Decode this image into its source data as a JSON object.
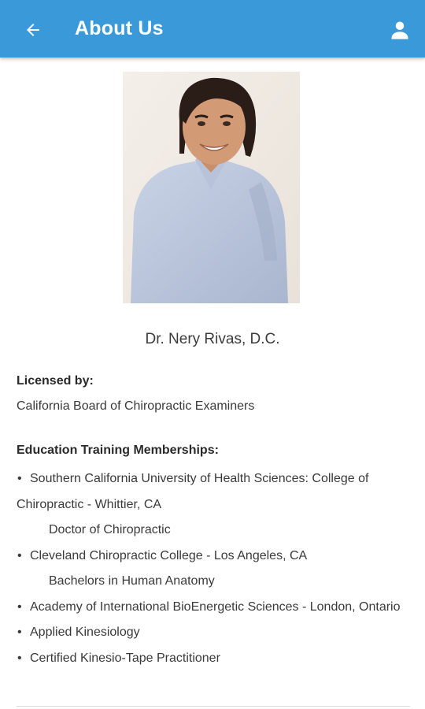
{
  "header": {
    "title": "About Us",
    "back_icon": "arrow-left-icon",
    "profile_icon": "user-icon",
    "bar_color": "#3a9ad9"
  },
  "profile": {
    "name": "Dr. Nery Rivas, D.C."
  },
  "license": {
    "heading": "Licensed by:",
    "text": "California Board of Chiropractic Examiners"
  },
  "education": {
    "heading": "Education Training Memberships:",
    "items": [
      {
        "bullet": "•",
        "text": "Southern California University of Health Sciences: College of Chiropractic - Whittier, CA",
        "sub": "Doctor of Chiropractic"
      },
      {
        "bullet": "•",
        "text": "Cleveland Chiropractic College - Los Angeles, CA",
        "sub": "Bachelors in Human Anatomy"
      },
      {
        "bullet": "•",
        "text": "Academy of International BioEnergetic Sciences - London, Ontario"
      },
      {
        "bullet": "•",
        "text": "Applied Kinesiology"
      },
      {
        "bullet": "•",
        "text": "Certified Kinesio-Tape Practitioner"
      }
    ]
  }
}
